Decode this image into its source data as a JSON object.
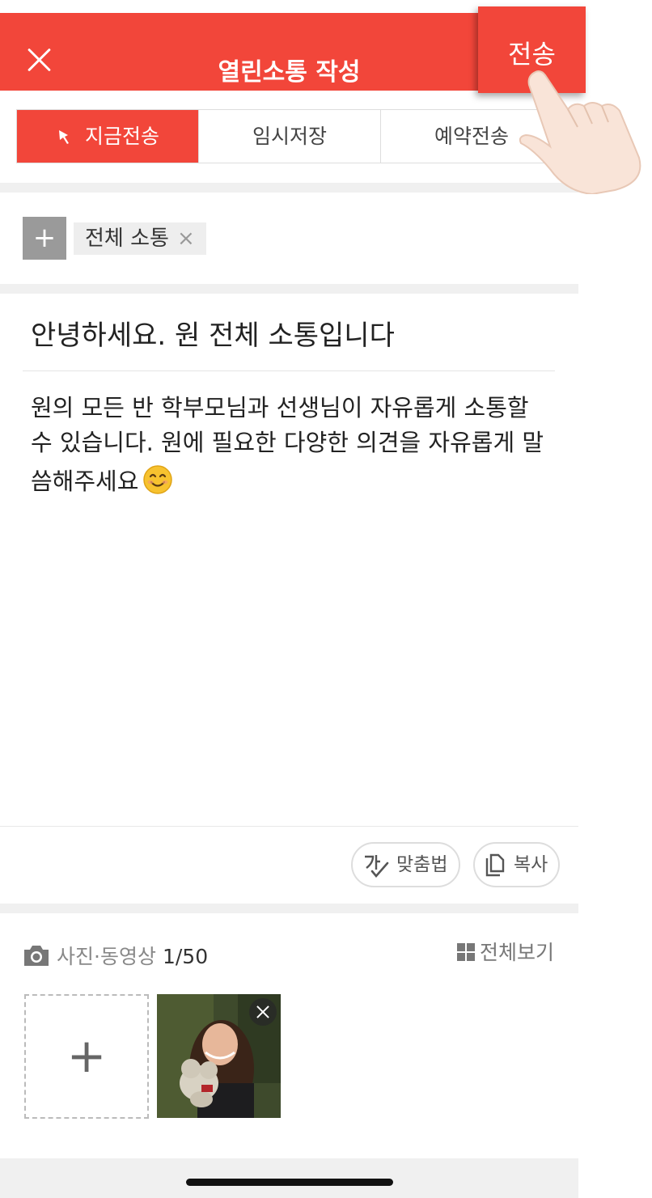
{
  "header": {
    "title": "열린소통 작성",
    "send_label": "전송",
    "close_icon": "close-icon"
  },
  "mode_tabs": [
    {
      "label": "지금전송",
      "active": true,
      "icon": "pin-icon"
    },
    {
      "label": "임시저장",
      "active": false
    },
    {
      "label": "예약전송",
      "active": false
    }
  ],
  "recipients": {
    "add_label": "+",
    "chip_label": "전체 소통",
    "chip_remove": "×"
  },
  "post": {
    "title": "안녕하세요. 원 전체 소통입니다",
    "body": "원의 모든 반 학부모님과 선생님이 자유롭게 소통할 수 있습니다. 원에 필요한 다양한 의견을 자유롭게 말씀해주세요",
    "emoji": "smiling-face-emoji"
  },
  "tools": {
    "spellcheck_label": "맞춤법",
    "copy_label": "복사"
  },
  "media": {
    "label": "사진·동영상",
    "count": "1/50",
    "view_all_label": "전체보기",
    "add_label": "+"
  },
  "colors": {
    "accent": "#f2463a",
    "divider": "#f0f0f0"
  }
}
